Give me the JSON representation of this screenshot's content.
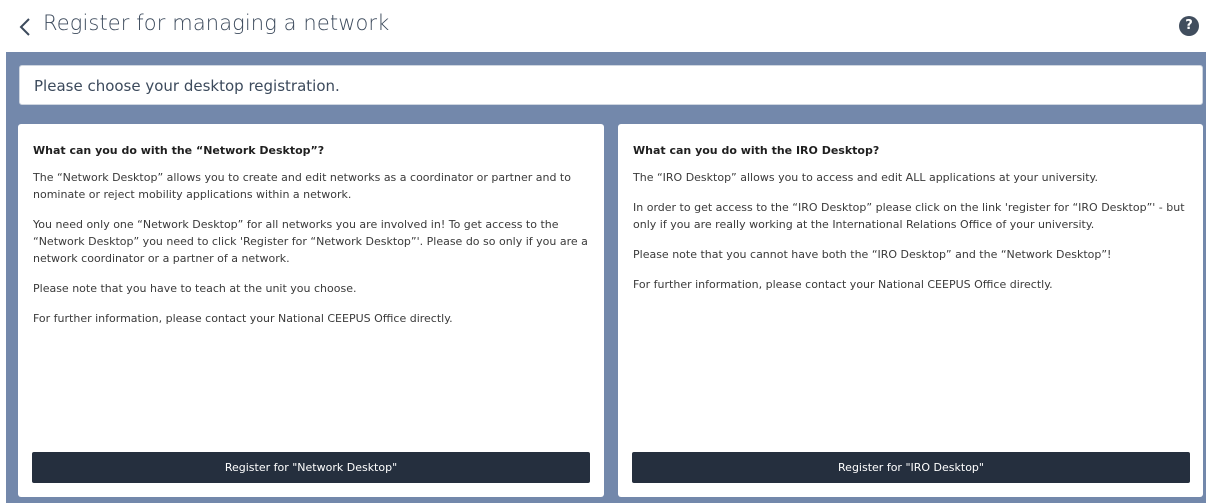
{
  "header": {
    "title": "Register for managing a network",
    "help_label": "?"
  },
  "banner": {
    "text": "Please choose your desktop registration."
  },
  "network_card": {
    "heading": "What can you do with the “Network Desktop”?",
    "paragraphs": [
      "The “Network Desktop” allows you to create and edit networks as a coordinator or partner and to nominate or reject mobility applications within a network.",
      "You need only one “Network Desktop” for all networks you are involved in! To get access to the “Network Desktop” you need to click 'Register for “Network Desktop”'. Please do so only if you are a network coordinator or a partner of a network.",
      "Please note that you have to teach at the unit you choose.",
      "For further information, please contact your National CEEPUS Office directly."
    ],
    "button_label": "Register for \"Network Desktop\""
  },
  "iro_card": {
    "heading": "What can you do with the IRO Desktop?",
    "paragraphs": [
      "The “IRO Desktop” allows you to access and edit ALL applications at your university.",
      "In order to get access to the “IRO Desktop” please click on the link 'register for “IRO Desktop”' - but only if you are really working at the International Relations Office of your university.",
      "Please note that you cannot have both the “IRO Desktop” and the “Network Desktop”!",
      "For further information, please contact your National CEEPUS Office directly."
    ],
    "button_label": "Register for \"IRO Desktop\""
  },
  "colors": {
    "workspace_bg": "#7388ab",
    "button_bg": "#252f3e",
    "title_color": "#3c4a5c"
  }
}
